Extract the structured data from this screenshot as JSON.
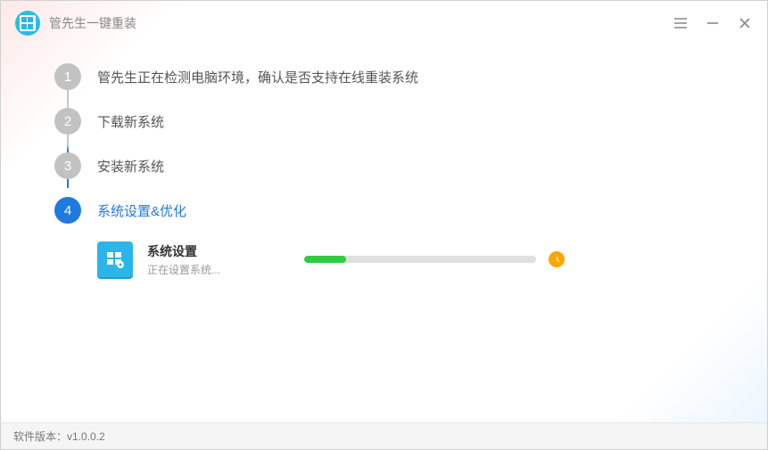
{
  "app": {
    "title": "管先生一键重装"
  },
  "steps": [
    {
      "num": "1",
      "label": "管先生正在检测电脑环境，确认是否支持在线重装系统",
      "active": false
    },
    {
      "num": "2",
      "label": "下载新系统",
      "active": false
    },
    {
      "num": "3",
      "label": "安装新系统",
      "active": false
    },
    {
      "num": "4",
      "label": "系统设置&优化",
      "active": true
    }
  ],
  "substep": {
    "title": "系统设置",
    "status": "正在设置系统...",
    "progress_percent": 18
  },
  "footer": {
    "version_label": "软件版本：",
    "version": "v1.0.0.2"
  }
}
